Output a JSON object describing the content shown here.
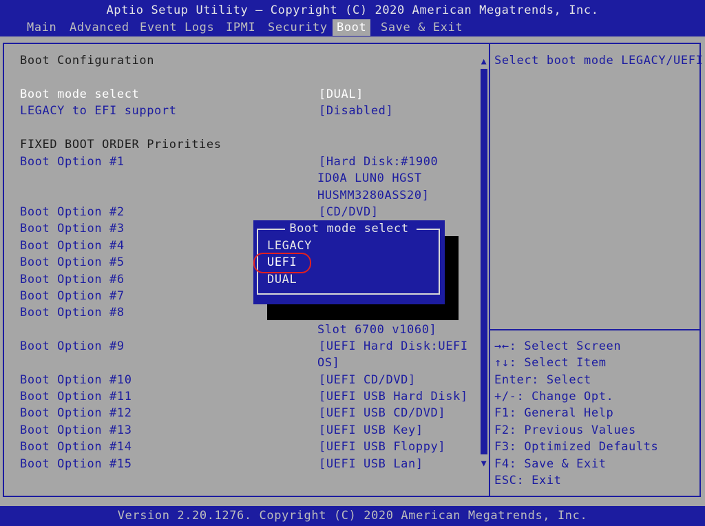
{
  "header": {
    "title": "Aptio Setup Utility – Copyright (C) 2020 American Megatrends, Inc.",
    "tabs": [
      "Main",
      "Advanced",
      "Event Logs",
      "IPMI",
      "Security",
      "Boot",
      "Save & Exit"
    ],
    "active_tab": "Boot"
  },
  "main": {
    "section_title": "Boot Configuration",
    "boot_mode_label": "Boot mode select",
    "boot_mode_value": "[DUAL]",
    "legacy_efi_label": "LEGACY to EFI support",
    "legacy_efi_value": "[Disabled]",
    "fixed_order_title": "FIXED BOOT ORDER Priorities",
    "options": [
      {
        "label": "Boot Option #1",
        "value": [
          "[Hard Disk:#1900",
          "ID0A LUN0 HGST",
          "HUSMM3280ASS20]"
        ]
      },
      {
        "label": "Boot Option #2",
        "value": [
          "[CD/DVD]"
        ]
      },
      {
        "label": "Boot Option #3",
        "value": []
      },
      {
        "label": "Boot Option #4",
        "value": []
      },
      {
        "label": "Boot Option #5",
        "value": []
      },
      {
        "label": "Boot Option #6",
        "value": []
      },
      {
        "label": "Boot Option #7",
        "value": []
      },
      {
        "label": "Boot Option #8",
        "value": [
          "Slot 6700 v1060]"
        ]
      },
      {
        "label": "Boot Option #9",
        "value": [
          "[UEFI Hard Disk:UEFI",
          "OS]"
        ]
      },
      {
        "label": "Boot Option #10",
        "value": [
          "[UEFI CD/DVD]"
        ]
      },
      {
        "label": "Boot Option #11",
        "value": [
          "[UEFI USB Hard Disk]"
        ]
      },
      {
        "label": "Boot Option #12",
        "value": [
          "[UEFI USB CD/DVD]"
        ]
      },
      {
        "label": "Boot Option #13",
        "value": [
          "[UEFI USB Key]"
        ]
      },
      {
        "label": "Boot Option #14",
        "value": [
          "[UEFI USB Floppy]"
        ]
      },
      {
        "label": "Boot Option #15",
        "value": [
          "[UEFI USB Lan]"
        ]
      }
    ]
  },
  "help": {
    "description": "Select boot mode LEGACY/UEFI",
    "keys": [
      "→←: Select Screen",
      "↑↓: Select Item",
      "Enter: Select",
      "+/-: Change Opt.",
      "F1: General Help",
      "F2: Previous Values",
      "F3: Optimized Defaults",
      "F4: Save & Exit",
      "ESC: Exit"
    ]
  },
  "popup": {
    "title": "Boot mode select",
    "items": [
      "LEGACY",
      "UEFI",
      "DUAL"
    ],
    "selected": "UEFI"
  },
  "scrollbar": {
    "up_icon": "▲",
    "down_icon": "▼"
  },
  "footer": {
    "text": "Version 2.20.1276. Copyright (C) 2020 American Megatrends, Inc."
  },
  "colors": {
    "bios_blue": "#1c1ca0",
    "panel_gray": "#a6a6a6",
    "highlight_red": "#e02020"
  }
}
